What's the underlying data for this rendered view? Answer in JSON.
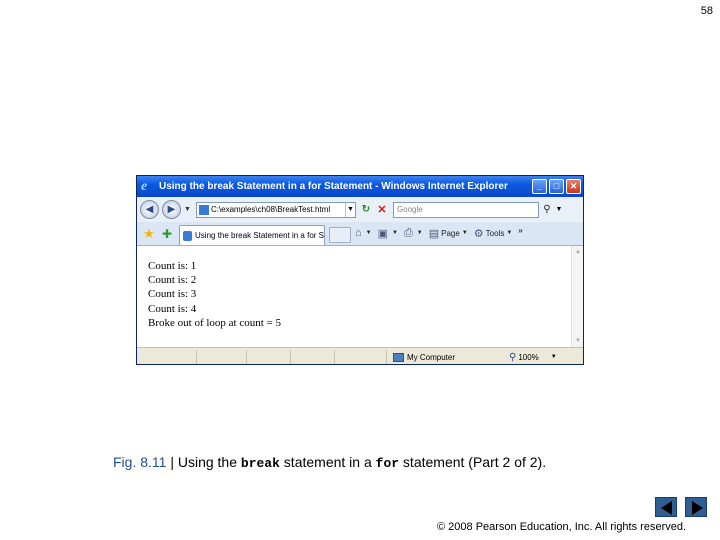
{
  "slide": {
    "page_number": "58",
    "copyright": "© 2008 Pearson Education, Inc.  All rights reserved.",
    "caption": {
      "fig": "Fig. 8.11",
      "sep": " | ",
      "pre": "Using the ",
      "code1": "break",
      "mid": " statement in a ",
      "code2": "for",
      "post": " statement (Part 2 of 2)."
    }
  },
  "window": {
    "title": "Using the break Statement in a for Statement - Windows Internet Explorer",
    "address": "C:\\examples\\ch08\\BreakTest.html",
    "search_placeholder": "Google",
    "tab_label": "Using the break Statement in a for S",
    "tools": {
      "page_label": "Page",
      "tools_label": "Tools"
    },
    "content_lines": [
      "Count is: 1",
      "Count is: 2",
      "Count is: 3",
      "Count is: 4",
      "Broke out of loop at count = 5"
    ],
    "status": {
      "zone": "My Computer",
      "zoom": "100%"
    }
  }
}
